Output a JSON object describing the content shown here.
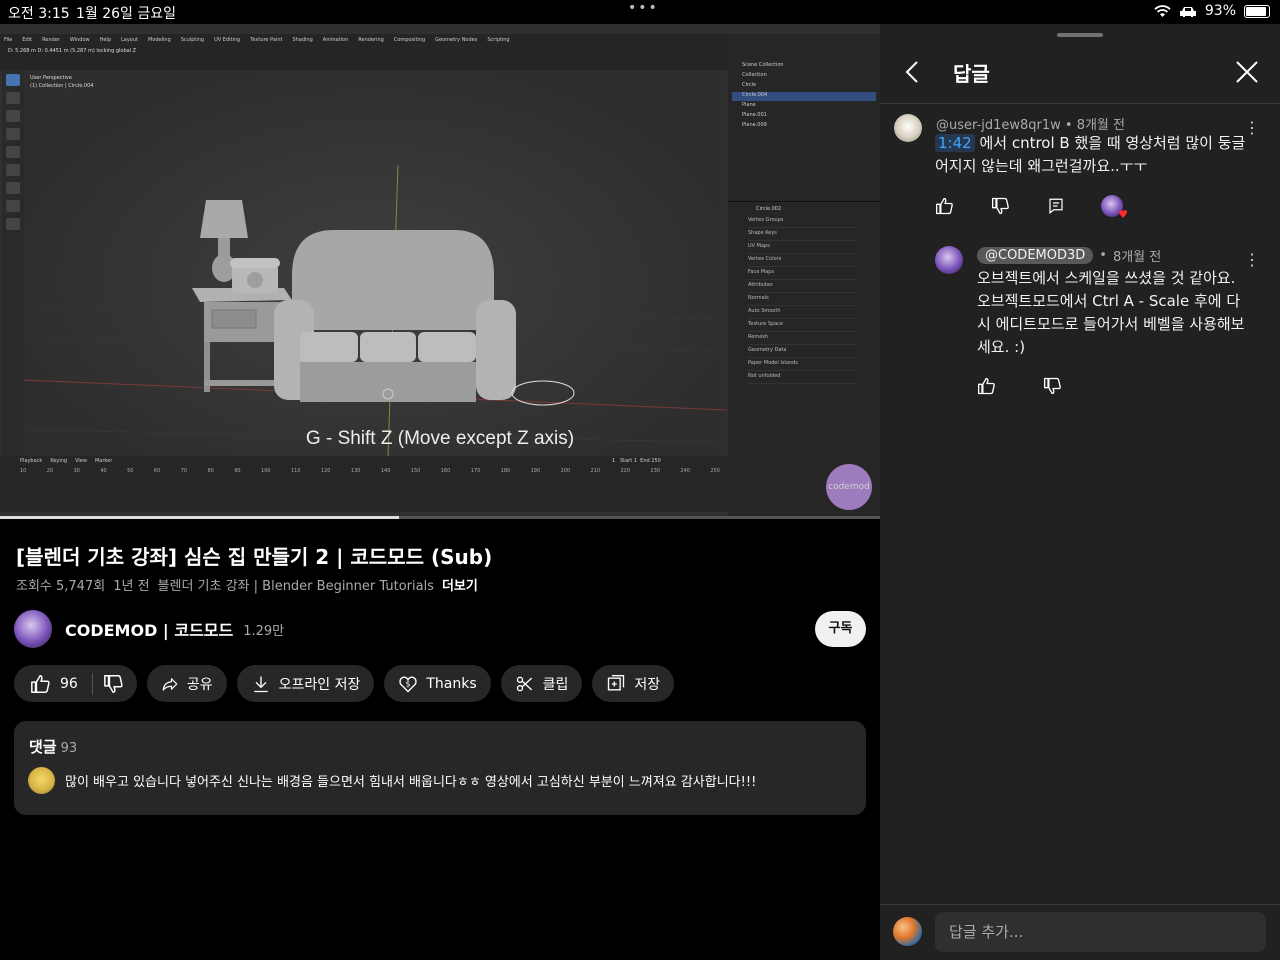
{
  "status_bar": {
    "time": "오전 3:15",
    "date": "1월 26일 금요일",
    "multitask_dots": "•••",
    "battery": "93%",
    "battery_level": 0.93,
    "icons": [
      "wifi-icon",
      "car-icon",
      "battery-icon"
    ]
  },
  "video": {
    "subtitle": "G - Shift Z (Move except Z axis)",
    "progress": 0.453,
    "watermark": "codemod",
    "blender": {
      "menu": [
        "File",
        "Edit",
        "Render",
        "Window",
        "Help",
        "Layout",
        "Modeling",
        "Sculpting",
        "UV Editing",
        "Texture Paint",
        "Shading",
        "Animation",
        "Rendering",
        "Compositing",
        "Geometry Nodes",
        "Scripting"
      ],
      "info_line": "D: 5.268 m  D: 0.4451 m (5.287 m) locking global Z",
      "view_label_1": "User Perspective",
      "view_label_2": "(1) Collection | Circle.004",
      "outliner": [
        "Scene Collection",
        "Collection",
        "Circle",
        "Circle.004",
        "Plane",
        "Plane.001",
        "Plane.009"
      ],
      "properties_object": "Circle.002",
      "properties": [
        "Vertex Groups",
        "Shape Keys",
        "UV Maps",
        "Vertex Colors",
        "Face Maps",
        "Attributes",
        "Normals",
        "Auto Smooth",
        "Texture Space",
        "Remesh",
        "Geometry Data",
        "Paper Model Islands",
        "Not unfolded"
      ],
      "timeline_menu": [
        "Playback",
        "Keying",
        "View",
        "Marker"
      ],
      "frames": [
        "10",
        "20",
        "30",
        "40",
        "50",
        "60",
        "70",
        "80",
        "90",
        "100",
        "110",
        "120",
        "130",
        "140",
        "150",
        "160",
        "170",
        "180",
        "190",
        "200",
        "210",
        "220",
        "230",
        "240",
        "250"
      ],
      "current_frame": "1",
      "start": "Start",
      "start_val": "1",
      "end": "End",
      "end_val": "250"
    }
  },
  "video_info": {
    "title": "[블렌더 기초 강좌] 심슨 집 만들기 2 | 코드모드 (Sub)",
    "views": "조회수 5,747회",
    "age": "1년 전",
    "playlist": "블렌더 기초 강좌 | Blender Beginner Tutorials",
    "more": "더보기"
  },
  "channel": {
    "name": "CODEMOD | 코드모드",
    "subscribers": "1.29만",
    "subscribe_label": "구독"
  },
  "actions": {
    "like_count": "96",
    "share": "공유",
    "download": "오프라인 저장",
    "thanks": "Thanks",
    "clip": "클립",
    "save": "저장"
  },
  "comments": {
    "header": "댓글",
    "count": "93",
    "top_comment": "많이 배우고 있습니다  넣어주신 신나는 배경음 들으면서 힘내서 배웁니다ㅎㅎ 영상에서 고심하신 부분이 느껴져요 감사합니다!!!"
  },
  "reply_panel": {
    "title": "답글",
    "comment": {
      "author": "@user-jd1ew8qr1w",
      "age": "8개월 전",
      "timestamp": "1:42",
      "text": " 에서 cntrol B 했을 때 영상처럼 많이 둥글어지지 않는데 왜그런걸까요..ㅜㅜ"
    },
    "reply": {
      "author": "@CODEMOD3D",
      "age": "8개월 전",
      "text": "오브젝트에서 스케일을 쓰셨을 것 같아요. 오브젝트모드에서 Ctrl A - Scale 후에 다시 에디트모드로 들어가서 베벨을 사용해보세요. :)"
    },
    "reply_placeholder": "답글 추가..."
  }
}
